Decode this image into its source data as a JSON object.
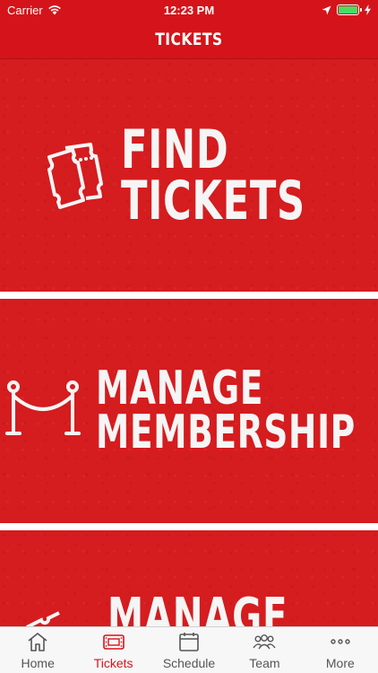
{
  "status_bar": {
    "carrier": "Carrier",
    "time": "12:23 PM",
    "battery_level": 1.0
  },
  "nav": {
    "title": "TICKETS"
  },
  "panels": [
    {
      "lines": [
        "FIND",
        "TICKETS"
      ],
      "icon": "tickets-icon"
    },
    {
      "lines": [
        "MANAGE",
        "MEMBERSHIP"
      ],
      "icon": "rope-barrier-icon"
    },
    {
      "lines": [
        "MANAGE"
      ],
      "icon": "ticket-icon"
    }
  ],
  "tabs": [
    {
      "label": "Home",
      "icon": "home-icon",
      "active": false
    },
    {
      "label": "Tickets",
      "icon": "ticket-icon",
      "active": true
    },
    {
      "label": "Schedule",
      "icon": "calendar-icon",
      "active": false
    },
    {
      "label": "Team",
      "icon": "team-icon",
      "active": false
    },
    {
      "label": "More",
      "icon": "more-icon",
      "active": false
    }
  ],
  "colors": {
    "brand_red": "#d4141a",
    "panel_red": "#d51c1f",
    "tab_active": "#d4141a",
    "tab_inactive": "#555555"
  }
}
